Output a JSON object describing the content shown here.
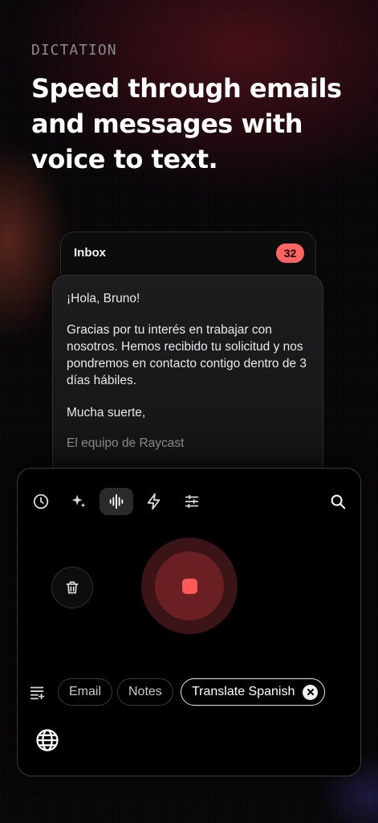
{
  "hero": {
    "eyebrow": "DICTATION",
    "headline": "Speed through emails and messages with voice to text."
  },
  "inbox": {
    "title": "Inbox",
    "badge_count": "32"
  },
  "email": {
    "greeting": "¡Hola, Bruno!",
    "body": "Gracias por tu interés en trabajar con nosotros. Hemos recibido tu solicitud y nos pondremos en contacto contigo dentro de 3 días hábiles.",
    "signoff": "Mucha suerte,",
    "team": "El equipo de Raycast"
  },
  "toolbar": {
    "items": [
      {
        "icon": "clock-icon"
      },
      {
        "icon": "sparkles-icon"
      },
      {
        "icon": "waveform-icon",
        "active": true
      },
      {
        "icon": "bolt-icon"
      },
      {
        "icon": "sliders-icon"
      },
      {
        "icon": "search-icon"
      }
    ]
  },
  "recorder": {
    "state": "recording",
    "accent": "#ff5a5a"
  },
  "presets": {
    "chips": [
      {
        "label": "Email",
        "selected": false
      },
      {
        "label": "Notes",
        "selected": false
      },
      {
        "label": "Translate Spanish",
        "selected": true
      }
    ]
  },
  "colors": {
    "badge": "#ff6464",
    "background": "#060406",
    "record_outer": "#3a1416",
    "record_inner": "#6a1f22"
  }
}
